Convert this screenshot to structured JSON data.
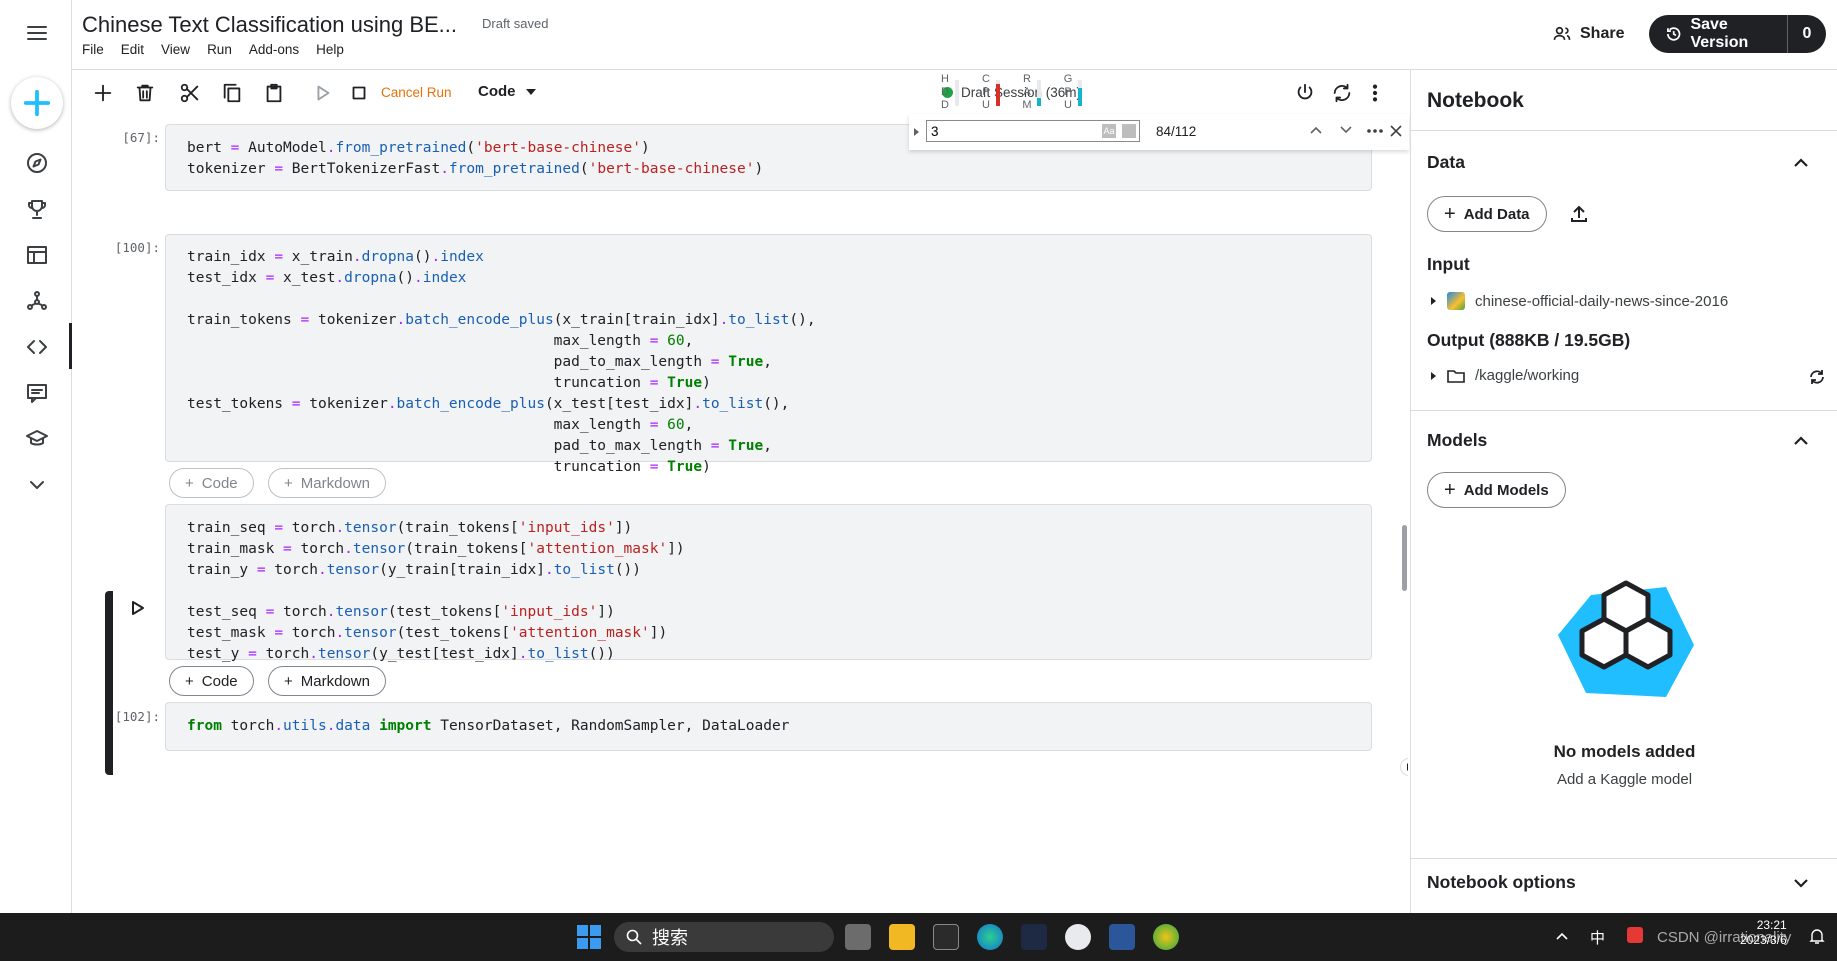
{
  "header": {
    "title": "Chinese Text Classification using BE...",
    "draft_status": "Draft saved",
    "menu": [
      "File",
      "Edit",
      "View",
      "Run",
      "Add-ons",
      "Help"
    ],
    "share_label": "Share",
    "save_label": "Save Version",
    "save_count": "0"
  },
  "toolbar": {
    "cancel_run": "Cancel Run",
    "cell_type": "Code",
    "session": "Draft Session (36m)",
    "meters": [
      {
        "label": "H\nD\nD",
        "level": 0.0,
        "color": "#9aa0a6"
      },
      {
        "label": "C\nP\nU",
        "level": 0.85,
        "color": "#d93025"
      },
      {
        "label": "R\nA\nM",
        "level": 0.3,
        "color": "#12b5cb"
      },
      {
        "label": "G\nP\nU",
        "level": 0.7,
        "color": "#12b5cb"
      }
    ]
  },
  "findbar": {
    "query": "3",
    "count": "84/112"
  },
  "cells": {
    "c67": {
      "prompt": "[67]:"
    },
    "c100": {
      "prompt": "[100]:"
    },
    "c102": {
      "prompt": "[102]:"
    }
  },
  "add_cell": {
    "code": "Code",
    "markdown": "Markdown"
  },
  "panel": {
    "title": "Notebook",
    "data_header": "Data",
    "add_data": "Add Data",
    "input_header": "Input",
    "input_dataset": "chinese-official-daily-news-since-2016",
    "output_header": "Output (888KB / 19.5GB)",
    "output_dir": "/kaggle/working",
    "models_header": "Models",
    "add_models": "Add Models",
    "no_models_title": "No models added",
    "no_models_sub": "Add a Kaggle model",
    "options_header": "Notebook options"
  },
  "taskbar": {
    "search_placeholder": "搜索",
    "ime": "中",
    "tray_text": "CSDN @irrationality",
    "clock_time": "23:21",
    "clock_date": "2023/3/6"
  }
}
